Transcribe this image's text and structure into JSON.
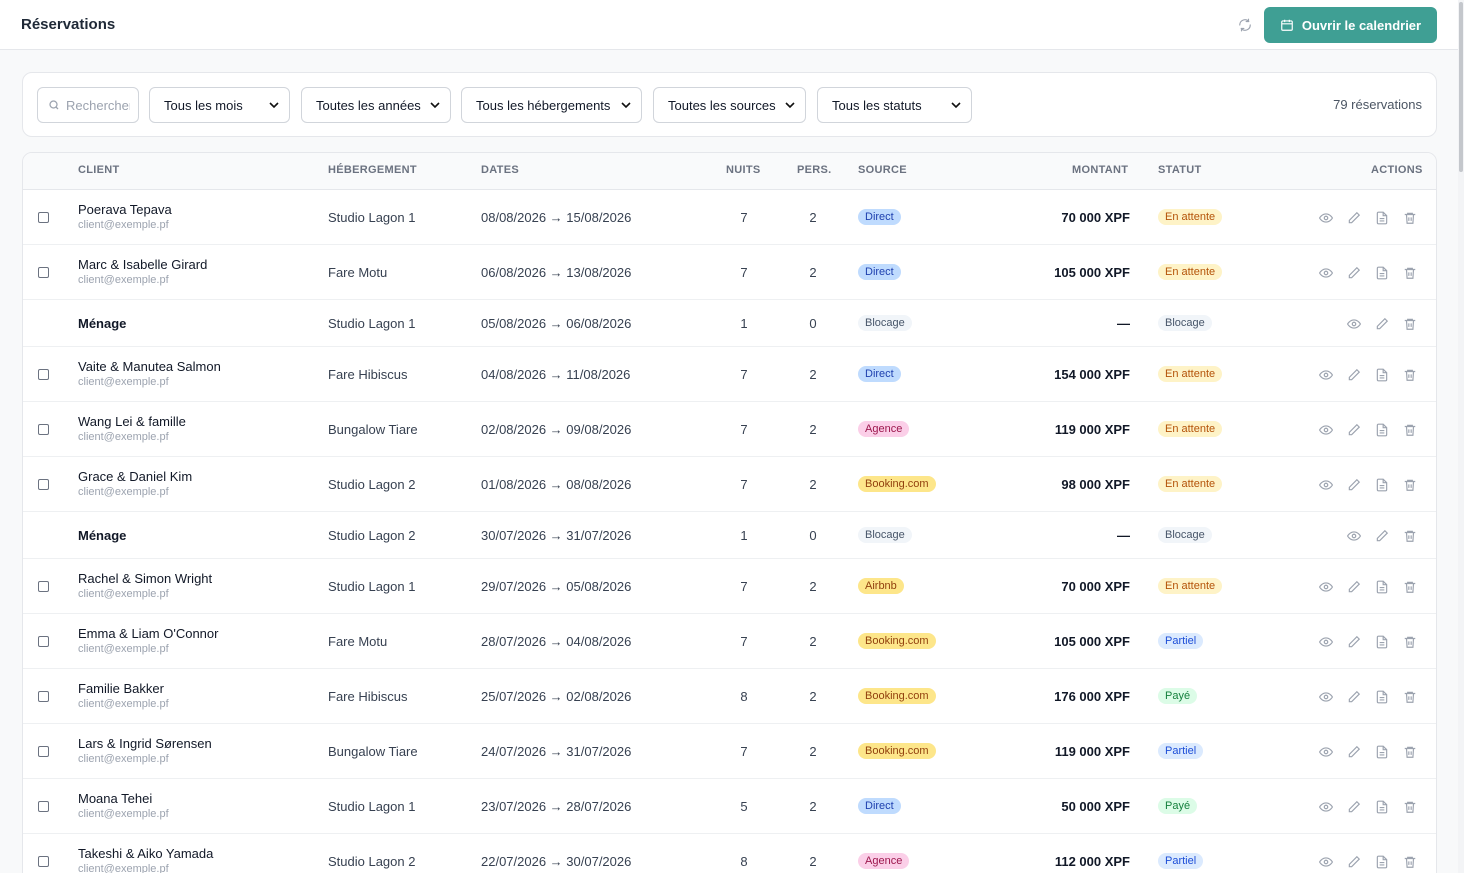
{
  "header": {
    "title": "Réservations",
    "calendar_button": "Ouvrir le calendrier"
  },
  "filters": {
    "search_placeholder": "Rechercher...",
    "month": "Tous les mois",
    "year": "Toutes les années",
    "accommodation": "Tous les hébergements",
    "source": "Toutes les sources",
    "status": "Tous les statuts",
    "count": "79 réservations"
  },
  "columns": {
    "client": "CLIENT",
    "accommodation": "HÉBERGEMENT",
    "dates": "DATES",
    "nights": "NUITS",
    "guests": "PERS.",
    "source": "SOURCE",
    "amount": "MONTANT",
    "status": "STATUT",
    "actions": "ACTIONS"
  },
  "badge_colors": {
    "Direct": {
      "bg": "#bfdbfe",
      "fg": "#1e40af"
    },
    "Agence": {
      "bg": "#fbcfe8",
      "fg": "#9d174d"
    },
    "Booking.com": {
      "bg": "#fde68a",
      "fg": "#92400e"
    },
    "Airbnb": {
      "bg": "#fde68a",
      "fg": "#92400e"
    },
    "Blocage": {
      "bg": "#f1f5f9",
      "fg": "#475569"
    },
    "En attente": {
      "bg": "#fef3c7",
      "fg": "#b45309"
    },
    "Partiel": {
      "bg": "#dbeafe",
      "fg": "#1d4ed8"
    },
    "Payé": {
      "bg": "#dcfce7",
      "fg": "#15803d"
    }
  },
  "rows": [
    {
      "client": "Poerava Tepava",
      "email": "client@exemple.pf",
      "accommodation": "Studio Lagon 1",
      "dates": "08/08/2026 → 15/08/2026",
      "nights": "7",
      "guests": "2",
      "source": "Direct",
      "amount": "70 000 XPF",
      "status": "En attente",
      "block": false
    },
    {
      "client": "Marc & Isabelle Girard",
      "email": "client@exemple.pf",
      "accommodation": "Fare Motu",
      "dates": "06/08/2026 → 13/08/2026",
      "nights": "7",
      "guests": "2",
      "source": "Direct",
      "amount": "105 000 XPF",
      "status": "En attente",
      "block": false
    },
    {
      "client": "Ménage",
      "email": "",
      "accommodation": "Studio Lagon 1",
      "dates": "05/08/2026 → 06/08/2026",
      "nights": "1",
      "guests": "0",
      "source": "Blocage",
      "amount": "—",
      "status": "Blocage",
      "block": true
    },
    {
      "client": "Vaite & Manutea Salmon",
      "email": "client@exemple.pf",
      "accommodation": "Fare Hibiscus",
      "dates": "04/08/2026 → 11/08/2026",
      "nights": "7",
      "guests": "2",
      "source": "Direct",
      "amount": "154 000 XPF",
      "status": "En attente",
      "block": false
    },
    {
      "client": "Wang Lei & famille",
      "email": "client@exemple.pf",
      "accommodation": "Bungalow Tiare",
      "dates": "02/08/2026 → 09/08/2026",
      "nights": "7",
      "guests": "2",
      "source": "Agence",
      "amount": "119 000 XPF",
      "status": "En attente",
      "block": false
    },
    {
      "client": "Grace & Daniel Kim",
      "email": "client@exemple.pf",
      "accommodation": "Studio Lagon 2",
      "dates": "01/08/2026 → 08/08/2026",
      "nights": "7",
      "guests": "2",
      "source": "Booking.com",
      "amount": "98 000 XPF",
      "status": "En attente",
      "block": false
    },
    {
      "client": "Ménage",
      "email": "",
      "accommodation": "Studio Lagon 2",
      "dates": "30/07/2026 → 31/07/2026",
      "nights": "1",
      "guests": "0",
      "source": "Blocage",
      "amount": "—",
      "status": "Blocage",
      "block": true
    },
    {
      "client": "Rachel & Simon Wright",
      "email": "client@exemple.pf",
      "accommodation": "Studio Lagon 1",
      "dates": "29/07/2026 → 05/08/2026",
      "nights": "7",
      "guests": "2",
      "source": "Airbnb",
      "amount": "70 000 XPF",
      "status": "En attente",
      "block": false
    },
    {
      "client": "Emma & Liam O'Connor",
      "email": "client@exemple.pf",
      "accommodation": "Fare Motu",
      "dates": "28/07/2026 → 04/08/2026",
      "nights": "7",
      "guests": "2",
      "source": "Booking.com",
      "amount": "105 000 XPF",
      "status": "Partiel",
      "block": false
    },
    {
      "client": "Familie Bakker",
      "email": "client@exemple.pf",
      "accommodation": "Fare Hibiscus",
      "dates": "25/07/2026 → 02/08/2026",
      "nights": "8",
      "guests": "2",
      "source": "Booking.com",
      "amount": "176 000 XPF",
      "status": "Payé",
      "block": false
    },
    {
      "client": "Lars & Ingrid Sørensen",
      "email": "client@exemple.pf",
      "accommodation": "Bungalow Tiare",
      "dates": "24/07/2026 → 31/07/2026",
      "nights": "7",
      "guests": "2",
      "source": "Booking.com",
      "amount": "119 000 XPF",
      "status": "Partiel",
      "block": false
    },
    {
      "client": "Moana Tehei",
      "email": "client@exemple.pf",
      "accommodation": "Studio Lagon 1",
      "dates": "23/07/2026 → 28/07/2026",
      "nights": "5",
      "guests": "2",
      "source": "Direct",
      "amount": "50 000 XPF",
      "status": "Payé",
      "block": false
    },
    {
      "client": "Takeshi & Aiko Yamada",
      "email": "client@exemple.pf",
      "accommodation": "Studio Lagon 2",
      "dates": "22/07/2026 → 30/07/2026",
      "nights": "8",
      "guests": "2",
      "source": "Agence",
      "amount": "112 000 XPF",
      "status": "Partiel",
      "block": false
    }
  ]
}
